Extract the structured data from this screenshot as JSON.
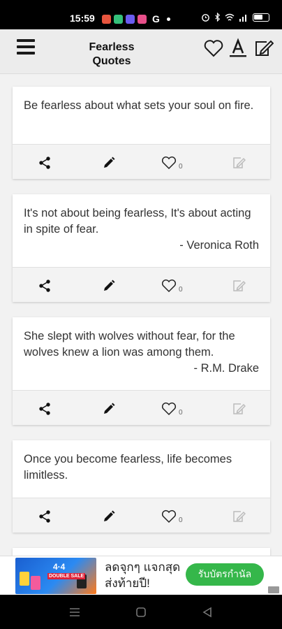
{
  "status_bar": {
    "time": "15:59",
    "g_label": "G",
    "icons": [
      "notification-icon",
      "app-icon",
      "app-icon",
      "google-icon",
      "dot-icon",
      "alarm-icon",
      "bluetooth-icon",
      "wifi-icon",
      "signal-icon",
      "battery-icon"
    ]
  },
  "app_bar": {
    "title": "Fearless Quotes",
    "icons": [
      "menu-icon",
      "heart-icon",
      "font-icon",
      "edit-icon"
    ]
  },
  "quotes": [
    {
      "text": "Be fearless about what sets your soul on fire.",
      "author": "",
      "likes": "0"
    },
    {
      "text": "It's not about being fearless, It's about acting in spite of fear.",
      "author": "- Veronica Roth",
      "likes": "0"
    },
    {
      "text": "She slept with wolves without fear, for the wolves knew a lion was among them.",
      "author": "- R.M. Drake",
      "likes": "0"
    },
    {
      "text": "Once you become fearless, life becomes limitless.",
      "author": "",
      "likes": "0"
    }
  ],
  "ad": {
    "image_title": "4·4",
    "image_subtitle": "DOUBLE SALE",
    "text": "ลดจุกๆ แจกสุดส่งท้ายปี!",
    "cta": "รับบัตรกำนัล"
  },
  "colors": {
    "app_bar_bg": "#ececec",
    "page_bg": "#f2f2f2",
    "action_bar_bg": "#f3f3f3",
    "cta_green": "#35b74a"
  }
}
